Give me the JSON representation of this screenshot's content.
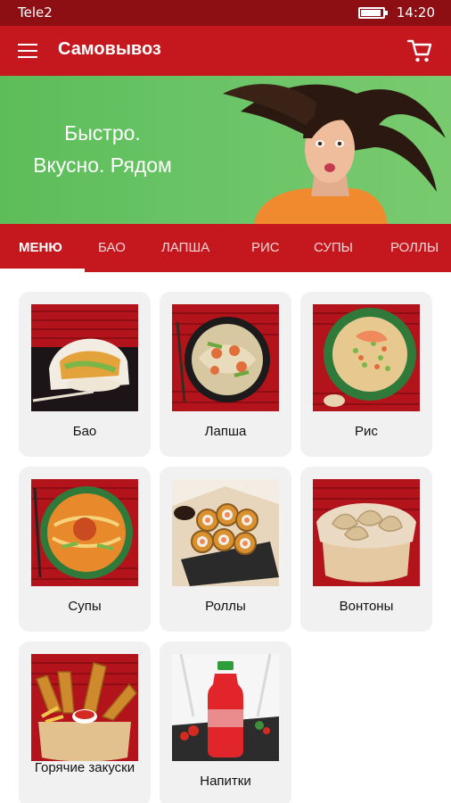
{
  "status_bar": {
    "carrier": "Tele2",
    "time": "14:20"
  },
  "app_bar": {
    "title": "Самовывоз",
    "menu_icon": "hamburger-menu-icon",
    "cart_icon": "shopping-cart-icon"
  },
  "banner": {
    "line1": "Быстро.",
    "line2": "Вкусно. Рядом"
  },
  "tabs": [
    {
      "label": "МЕНЮ",
      "active": true
    },
    {
      "label": "БАО"
    },
    {
      "label": "ЛАПША"
    },
    {
      "label": "РИС"
    },
    {
      "label": "СУПЫ"
    },
    {
      "label": "РОЛЛЫ"
    }
  ],
  "categories": [
    {
      "label": "Бао"
    },
    {
      "label": "Лапша"
    },
    {
      "label": "Рис"
    },
    {
      "label": "Супы"
    },
    {
      "label": "Роллы"
    },
    {
      "label": "Вонтоны"
    },
    {
      "label": "Горячие закуски"
    },
    {
      "label": "Напитки"
    }
  ],
  "colors": {
    "primary": "#c4171e",
    "status_bar": "#8d0f14",
    "banner_green": "#66c263",
    "card_bg": "#f1f1f1"
  }
}
